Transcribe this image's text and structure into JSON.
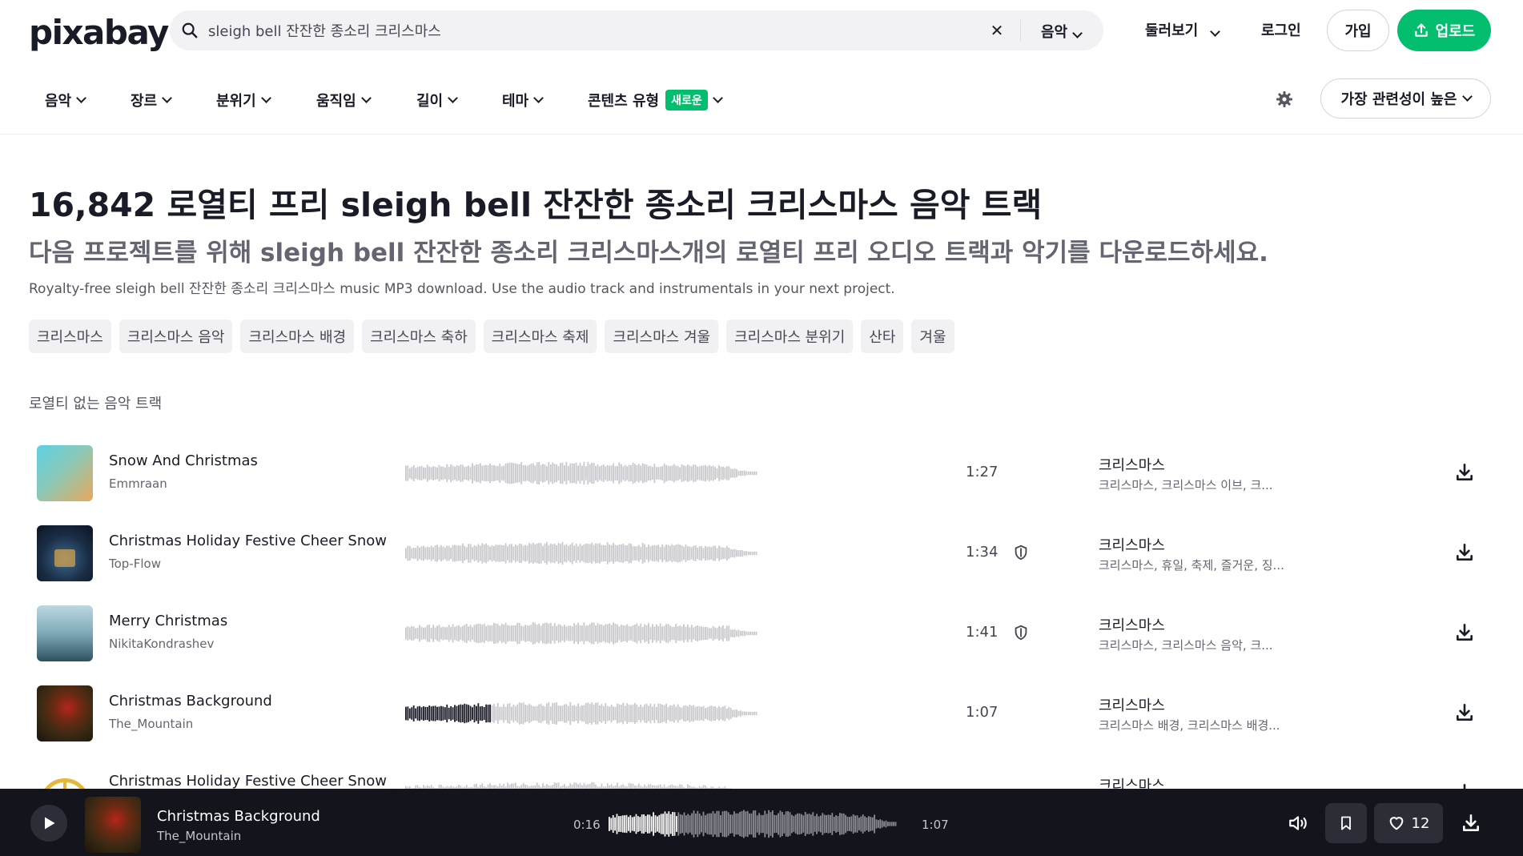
{
  "header": {
    "logo": "pixabay",
    "search_value": "sleigh bell 잔잔한 종소리 크리스마스",
    "search_type": "음악",
    "explore": "둘러보기",
    "login": "로그인",
    "join": "가입",
    "upload": "업로드"
  },
  "filters": {
    "items": [
      "음악",
      "장르",
      "분위기",
      "움직임",
      "길이",
      "테마",
      "콘텐츠 유형"
    ],
    "new_badge": "새로운",
    "sort": "가장 관련성이 높은"
  },
  "page": {
    "title": "16,842 로열티 프리 sleigh bell 잔잔한 종소리 크리스마스 음악 트랙",
    "subtitle": "다음 프로젝트를 위해 sleigh bell 잔잔한 종소리 크리스마스개의 로열티 프리 오디오 트랙과 악기를 다운로드하세요.",
    "description": "Royalty-free sleigh bell 잔잔한 종소리 크리스마스 music MP3 download. Use the audio track and instrumentals in your next project.",
    "tags": [
      "크리스마스",
      "크리스마스 음악",
      "크리스마스 배경",
      "크리스마스 축하",
      "크리스마스 축제",
      "크리스마스 겨울",
      "크리스마스 분위기",
      "산타",
      "겨울"
    ],
    "section_label": "로열티 없는 음악 트랙"
  },
  "tracks": [
    {
      "title": "Snow And Christmas",
      "artist": "Emmraan",
      "duration": "1:27",
      "category": "크리스마스",
      "tags": "크리스마스, 크리스마스 이브, 크...",
      "licensed": false,
      "played_fraction": 0
    },
    {
      "title": "Christmas Holiday Festive Cheer Snow",
      "artist": "Top-Flow",
      "duration": "1:34",
      "category": "크리스마스",
      "tags": "크리스마스, 휴일, 축제, 즐거운, 징...",
      "licensed": true,
      "played_fraction": 0
    },
    {
      "title": "Merry Christmas",
      "artist": "NikitaKondrashev",
      "duration": "1:41",
      "category": "크리스마스",
      "tags": "크리스마스, 크리스마스 음악, 크...",
      "licensed": true,
      "played_fraction": 0
    },
    {
      "title": "Christmas Background",
      "artist": "The_Mountain",
      "duration": "1:07",
      "category": "크리스마스",
      "tags": "크리스마스 배경, 크리스마스 배경...",
      "licensed": false,
      "played_fraction": 0.24
    },
    {
      "title": "Christmas Holiday Festive Cheer Snow",
      "artist": "",
      "duration": "",
      "category": "크리스마스",
      "tags": "",
      "licensed": false,
      "played_fraction": 0
    }
  ],
  "player": {
    "title": "Christmas Background",
    "artist": "The_Mountain",
    "current_time": "0:16",
    "total_time": "1:07",
    "played_fraction": 0.24,
    "likes": "12"
  },
  "colors": {
    "accent": "#02be6e",
    "wave": "#c9c9ce",
    "wave_played": "#191b26",
    "player_bg": "#14151c"
  }
}
